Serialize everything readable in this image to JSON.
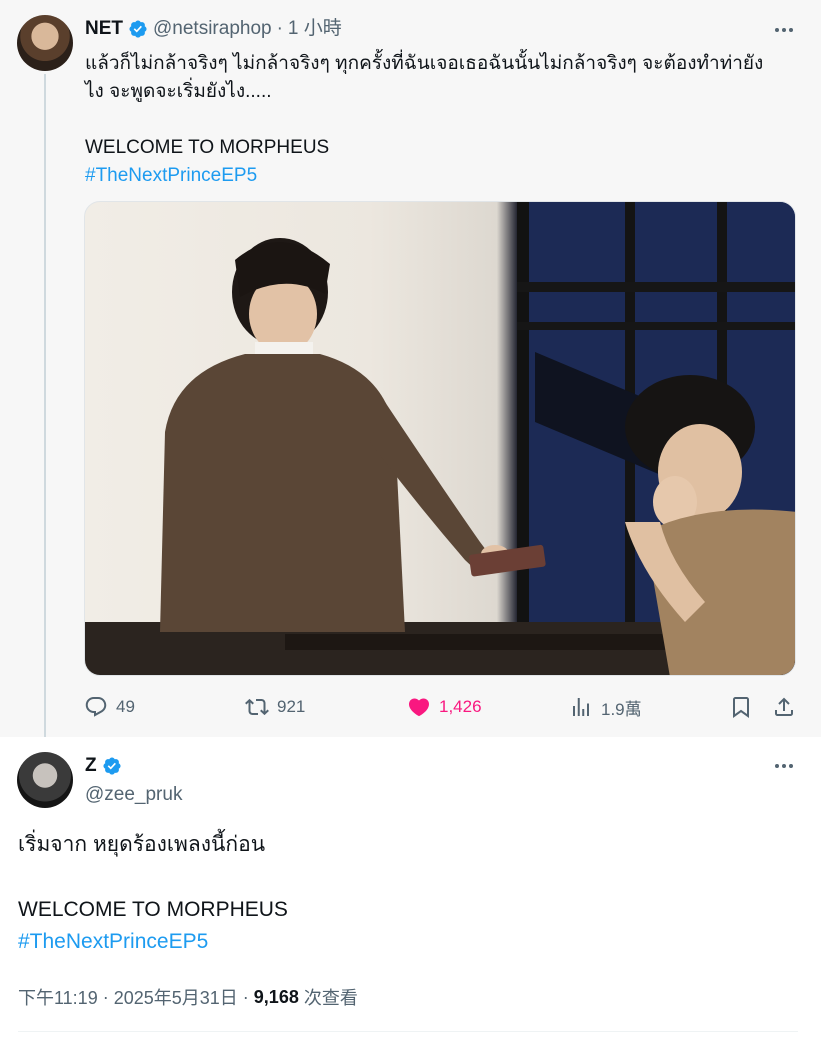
{
  "parent_tweet": {
    "display_name": "NET",
    "handle": "@netsiraphop",
    "separator": "·",
    "timestamp": "1 小時",
    "text_lines": [
      "แล้วก็ไม่กล้าจริงๆ ไม่กล้าจริงๆ ทุกครั้งที่ฉันเจอเธอฉันนั้นไม่กล้าจริงๆ จะต้องทำท่ายัง",
      "ไง จะพูดจะเริ่มยังไง....."
    ],
    "text_line_2": "WELCOME TO MORPHEUS",
    "hashtag": "#TheNextPrinceEP5",
    "media_icon": "photo",
    "actions": {
      "replies": "49",
      "retweets": "921",
      "likes": "1,426",
      "views": "1.9萬"
    },
    "icons": {
      "reply": "reply-icon",
      "retweet": "retweet-icon",
      "like": "heart-filled-icon",
      "views": "views-bar-icon",
      "bookmark": "bookmark-icon",
      "share": "share-icon",
      "verified": "verified-badge-icon",
      "more": "more-horizontal-icon"
    }
  },
  "reply_tweet": {
    "display_name": "Z",
    "handle": "@zee_pruk",
    "text_line_1": "เริ่มจาก หยุดร้องเพลงนี้ก่อน",
    "text_line_2": "WELCOME TO MORPHEUS",
    "hashtag": "#TheNextPrinceEP5",
    "time": "下午11:19",
    "separator": "·",
    "date": "2025年5月31日",
    "views_count": "9,168",
    "views_label": "次查看"
  },
  "colors": {
    "text_primary": "#0f1419",
    "text_secondary": "#536471",
    "link": "#1d9bf0",
    "like": "#f91880",
    "verified": "#1d9bf0",
    "parent_background": "#f7f7f7",
    "thread_line": "#cfd9de"
  }
}
